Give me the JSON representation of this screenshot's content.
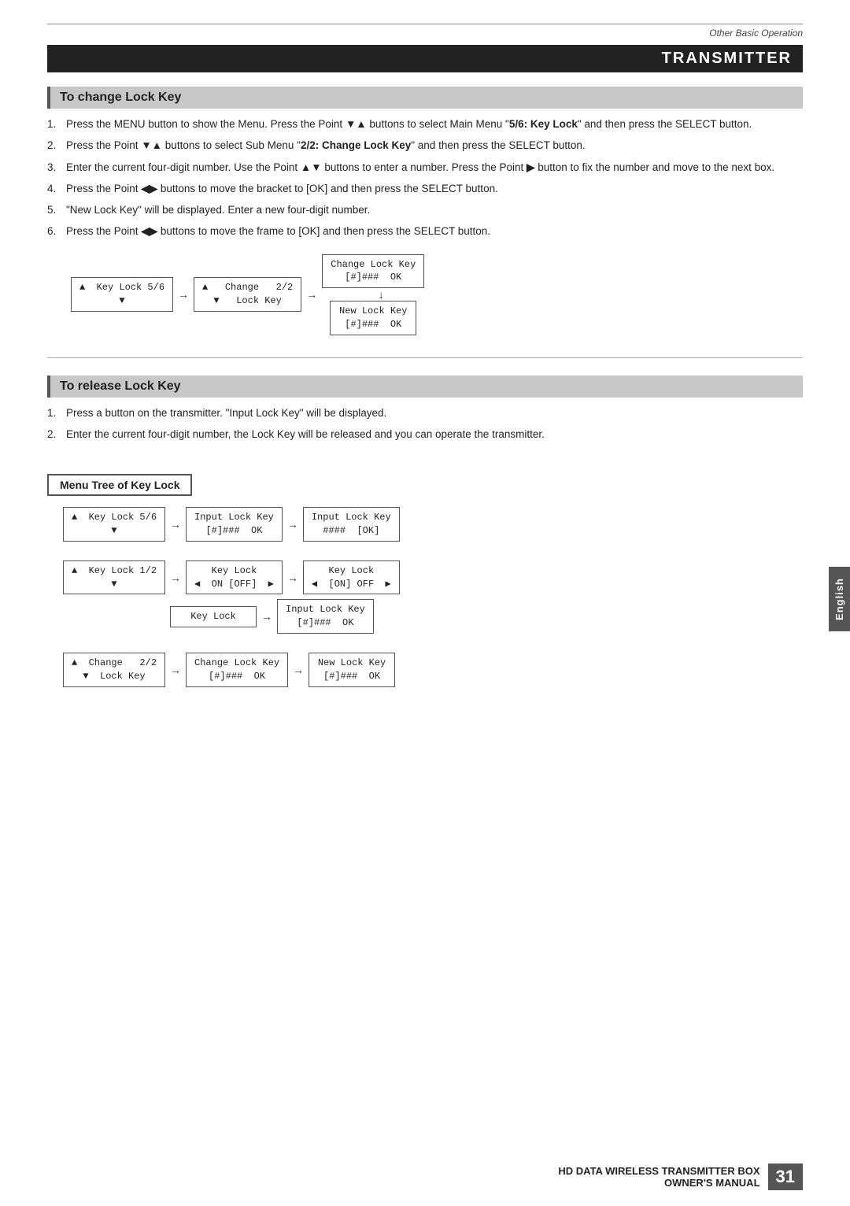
{
  "header": {
    "other_basic": "Other Basic Operation",
    "section_title": "TRANSMITTER"
  },
  "change_lock_key": {
    "title": "To change Lock Key",
    "steps": [
      {
        "num": "1.",
        "text_before": "Press the MENU button to show the Menu. Press the Point ",
        "symbol": "▼▲",
        "text_after": " buttons to select Main Menu \"",
        "bold": "5/6: Key Lock",
        "text_end": "\"  and then press the SELECT button."
      },
      {
        "num": "2.",
        "text_before": "Press the Point ",
        "symbol": "▼▲",
        "text_after": " buttons to select Sub Menu \"",
        "bold": "2/2: Change Lock Key",
        "text_end": "\" and then press the SELECT button."
      },
      {
        "num": "3.",
        "text_before": "Enter the current four-digit number. Use the Point ",
        "symbol": "▲▼",
        "text_after": " buttons to enter a number. Press the Point ",
        "symbol2": "▶",
        "text_end": " button to fix the number and move to the next box."
      },
      {
        "num": "4.",
        "text_before": "Press the Point ",
        "symbol": "◀▶",
        "text_end": " buttons to move the bracket to [OK] and then press the SELECT button."
      },
      {
        "num": "5.",
        "text": "\"New Lock Key\" will be displayed. Enter a new four-digit number."
      },
      {
        "num": "6.",
        "text_before": "Press the Point ",
        "symbol": "◀▶",
        "text_end": " buttons to move the frame to [OK] and then press the SELECT button."
      }
    ],
    "diagram": {
      "row1": {
        "box1_line1": "▲  Key Lock 5/6",
        "box1_line2": "▼",
        "box2_line1": "▲   Change   2/2",
        "box2_line2": "▼   Lock Key",
        "box3_line1": "Change Lock Key",
        "box3_line2": "[#]###  OK"
      },
      "row2": {
        "box1_line1": "New Lock Key",
        "box1_line2": "[#]###  OK"
      }
    }
  },
  "release_lock_key": {
    "title": "To release Lock Key",
    "steps": [
      {
        "num": "1.",
        "text": "Press a button on the transmitter. \"Input Lock Key\" will be displayed."
      },
      {
        "num": "2.",
        "text": "Enter the current four-digit number, the Lock Key will be released and you can operate the transmitter."
      }
    ]
  },
  "menu_tree": {
    "title": "Menu Tree of Key Lock",
    "rows": [
      {
        "id": "row1",
        "box1": "▲  Key Lock 5/6\n▼",
        "box2": "Input Lock Key\n[#]###  OK",
        "box3": "Input Lock Key\n####  [OK]"
      },
      {
        "id": "row2",
        "box1": "▲  Key Lock 1/2\n▼",
        "box2": "Key Lock\n◀  ON [OFF]  ▶",
        "box3": "Key Lock\n◀  [ON] OFF  ▶"
      },
      {
        "id": "row2b",
        "box2": "Key Lock",
        "box3": "Input Lock Key\n[#]###  OK"
      },
      {
        "id": "row3",
        "box1": "▲  Change   2/2\n▼  Lock Key",
        "box2": "Change Lock Key\n[#]###  OK",
        "box3": "New Lock Key\n[#]###  OK"
      }
    ]
  },
  "side_tab": {
    "label": "English"
  },
  "footer": {
    "product_line1": "HD DATA WIRELESS TRANSMITTER BOX",
    "product_line2": "OWNER'S MANUAL",
    "page_number": "31"
  }
}
